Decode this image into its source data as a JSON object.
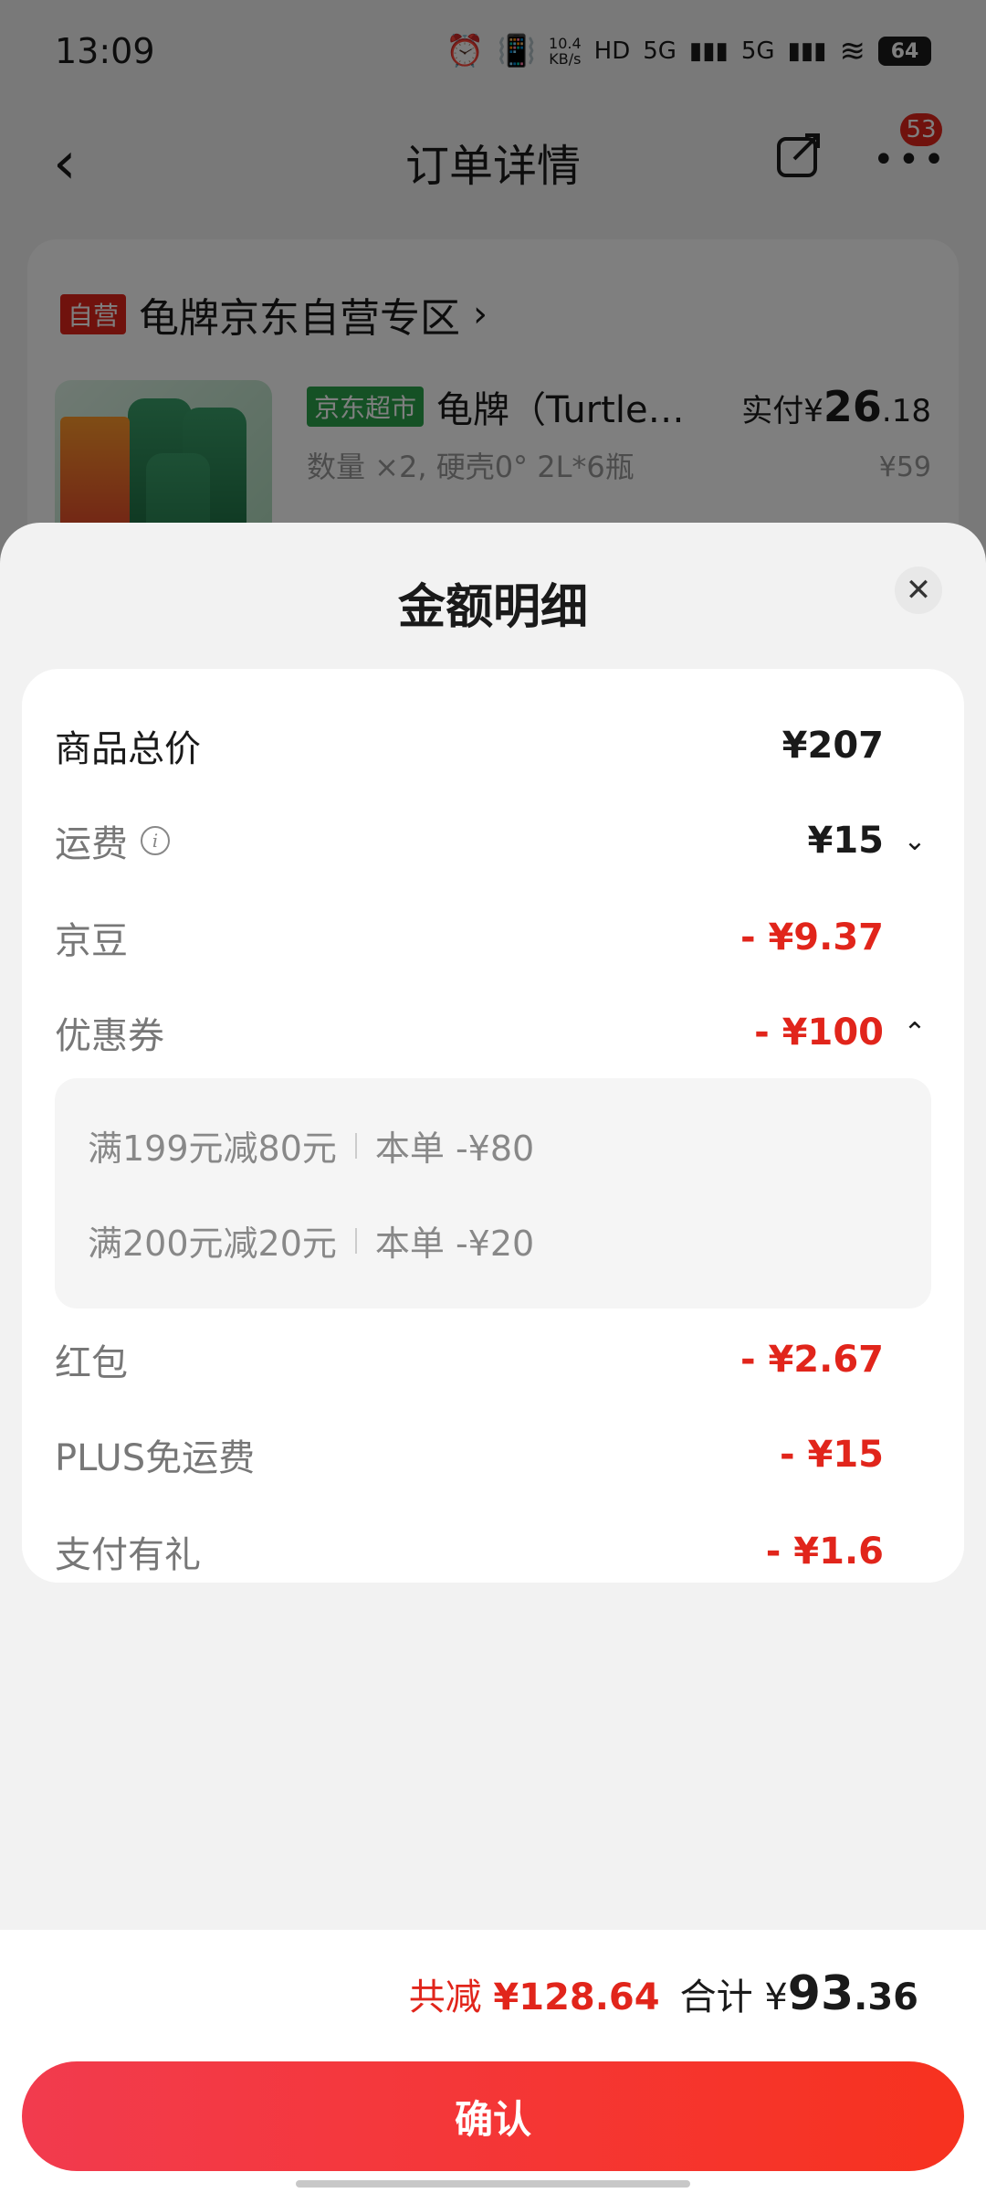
{
  "status_bar": {
    "time": "13:09",
    "net_speed": "10.4",
    "net_unit": "KB/s",
    "signal_1": "5G",
    "signal_2": "5G",
    "battery": "64"
  },
  "nav": {
    "title": "订单详情",
    "badge": "53"
  },
  "order": {
    "shop_tag": "自营",
    "shop_name": "龟牌京东自营专区",
    "product_tag": "京东超市",
    "product_title": "龟牌（Turtle…",
    "product_spec": "数量 ×2, 硬壳0° 2L*6瓶",
    "paid_label": "实付",
    "paid_currency": "¥",
    "paid_int": "26",
    "paid_dec": ".18",
    "original_price": "¥59"
  },
  "sheet": {
    "title": "金额明细",
    "rows": {
      "goods_total": {
        "label": "商品总价",
        "value": "¥207"
      },
      "shipping": {
        "label": "运费",
        "value": "¥15"
      },
      "jingdou": {
        "label": "京豆",
        "value": "- ¥9.37"
      },
      "coupon": {
        "label": "优惠券",
        "value": "- ¥100"
      },
      "red_packet": {
        "label": "红包",
        "value": "- ¥2.67"
      },
      "plus_free_ship": {
        "label": "PLUS免运费",
        "value": "- ¥15"
      },
      "pay_gift": {
        "label": "支付有礼",
        "value": "- ¥1.6"
      }
    },
    "coupons": [
      {
        "name": "满199元减80元",
        "detail": "本单 -¥80"
      },
      {
        "name": "满200元减20元",
        "detail": "本单 -¥20"
      }
    ]
  },
  "bottom": {
    "reduce_label": "共减",
    "reduce_value": "¥128.64",
    "total_label": "合计",
    "total_currency": "¥",
    "total_int": "93",
    "total_dec": ".36",
    "confirm_label": "确认"
  },
  "colors": {
    "accent_red": "#e1251b",
    "market_green": "#2aa34a"
  }
}
